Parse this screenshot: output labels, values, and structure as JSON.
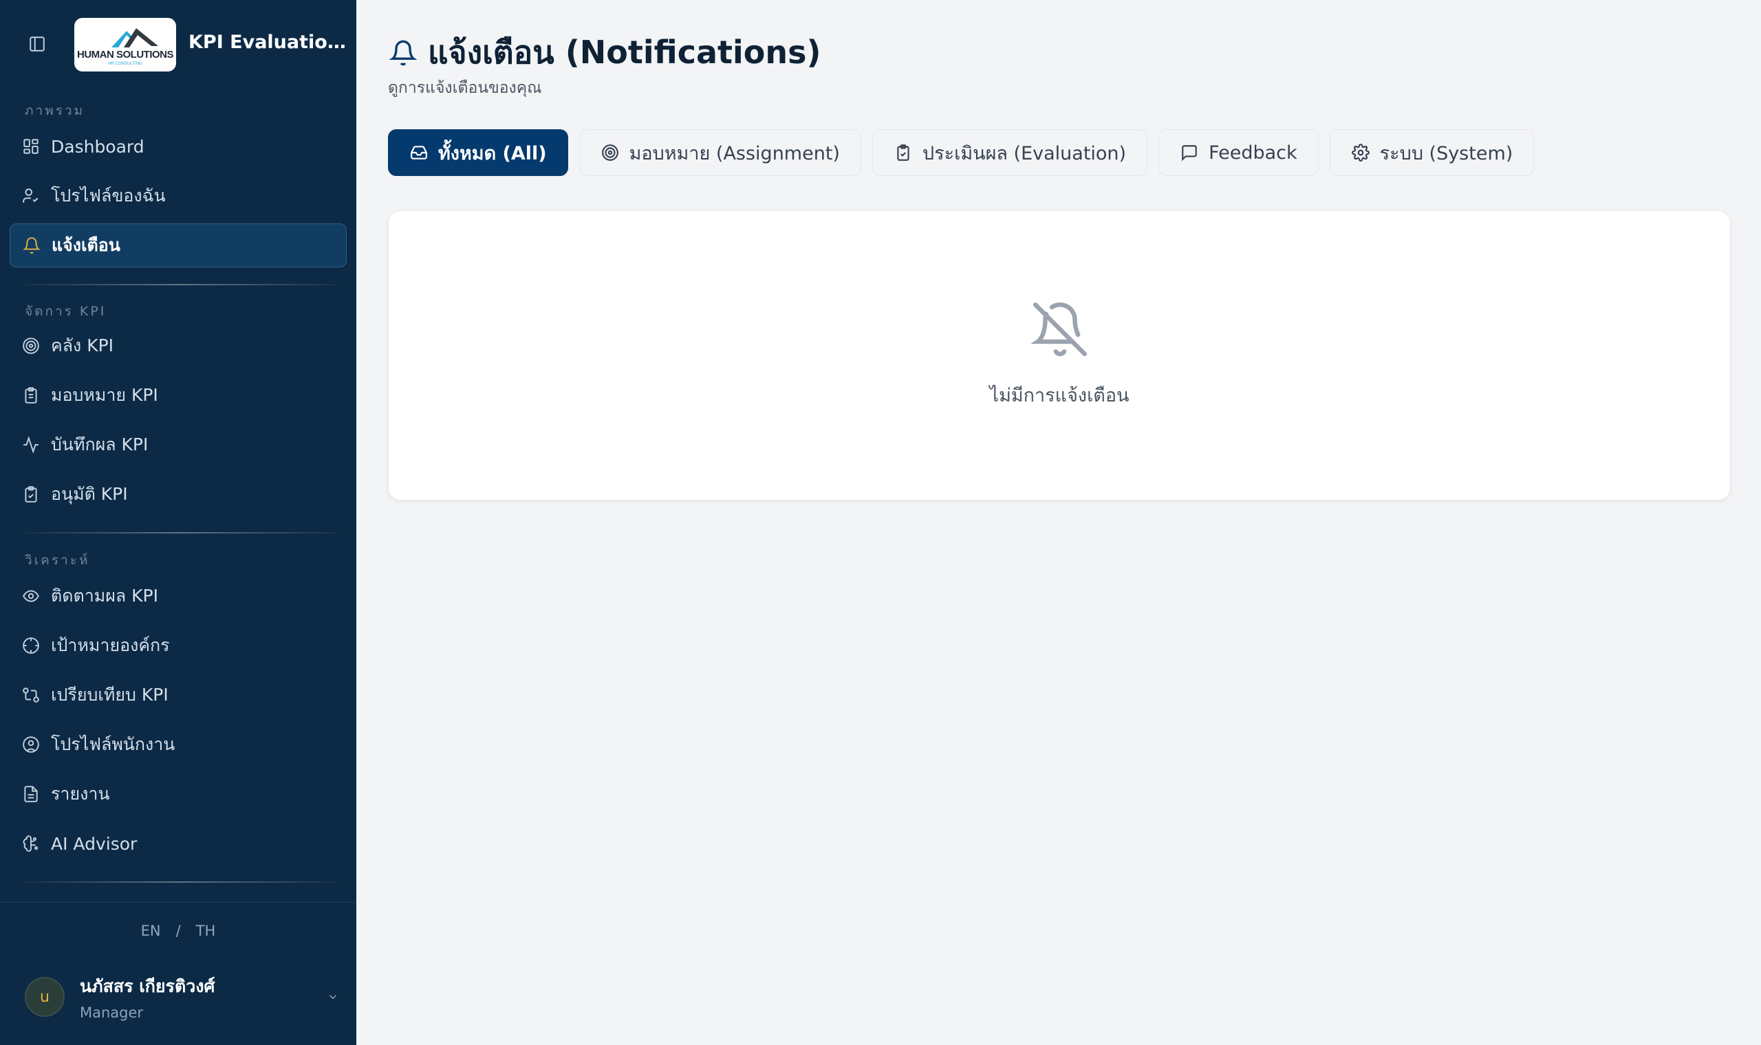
{
  "app": {
    "title": "KPI Evaluation System",
    "logo_text": "HUMAN SOLUTIONS",
    "logo_subtext": "HR CONSULTING"
  },
  "sidebar": {
    "sections": [
      {
        "label": "ภาพรวม"
      },
      {
        "label": "จัดการ KPI"
      },
      {
        "label": "วิเคราะห์"
      }
    ],
    "items": [
      {
        "label": "Dashboard",
        "icon": "dashboard-icon"
      },
      {
        "label": "โปรไฟล์ของฉัน",
        "icon": "user-check-icon"
      },
      {
        "label": "แจ้งเตือน",
        "icon": "bell-icon",
        "active": true
      },
      {
        "label": "คลัง KPI",
        "icon": "target-icon"
      },
      {
        "label": "มอบหมาย KPI",
        "icon": "clipboard-list-icon"
      },
      {
        "label": "บันทึกผล KPI",
        "icon": "activity-icon"
      },
      {
        "label": "อนุมัติ KPI",
        "icon": "clipboard-check-icon"
      },
      {
        "label": "ติดตามผล KPI",
        "icon": "eye-icon"
      },
      {
        "label": "เป้าหมายองค์กร",
        "icon": "crosshair-icon"
      },
      {
        "label": "เปรียบเทียบ KPI",
        "icon": "compare-icon"
      },
      {
        "label": "โปรไฟล์พนักงาน",
        "icon": "user-circle-icon"
      },
      {
        "label": "รายงาน",
        "icon": "file-text-icon"
      },
      {
        "label": "AI Advisor",
        "icon": "brain-icon"
      }
    ],
    "language": {
      "en": "EN",
      "separator": "/",
      "th": "TH"
    },
    "user": {
      "initial": "u",
      "name": "นภัสสร เกียรติวงศ์",
      "role": "Manager"
    }
  },
  "page": {
    "title": "แจ้งเตือน (Notifications)",
    "subtitle": "ดูการแจ้งเตือนของคุณ",
    "tabs": [
      {
        "label": "ทั้งหมด (All)",
        "icon": "inbox-icon",
        "active": true
      },
      {
        "label": "มอบหมาย (Assignment)",
        "icon": "target-icon"
      },
      {
        "label": "ประเมินผล (Evaluation)",
        "icon": "clipboard-check-icon"
      },
      {
        "label": "Feedback",
        "icon": "message-square-icon"
      },
      {
        "label": "ระบบ (System)",
        "icon": "gear-icon"
      }
    ],
    "empty_state": {
      "text": "ไม่มีการแจ้งเตือน",
      "icon": "bell-off-icon"
    }
  },
  "colors": {
    "sidebar_bg": "#0c2a46",
    "accent": "#053a6e",
    "active_nav_bg": "#123d63",
    "bell_accent": "#e3b341",
    "page_bg": "#f3f4f6"
  }
}
